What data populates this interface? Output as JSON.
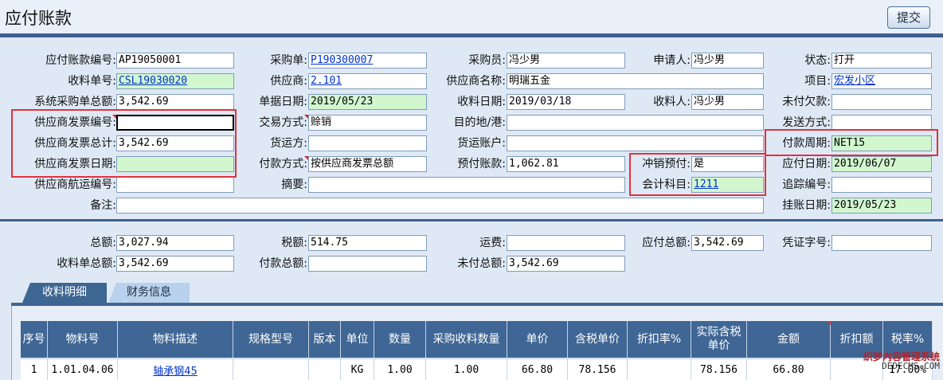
{
  "header": {
    "title": "应付账款",
    "submit_label": "提交"
  },
  "form": {
    "ap_no": {
      "label": "应付账款编号:",
      "value": "AP19050001"
    },
    "po": {
      "label": "采购单:",
      "value": "P190300007"
    },
    "buyer": {
      "label": "采购员:",
      "value": "冯少男"
    },
    "applicant": {
      "label": "申请人:",
      "value": "冯少男"
    },
    "status": {
      "label": "状态:",
      "value": "打开"
    },
    "receipt_no": {
      "label": "收料单号:",
      "value": "CSL19030020"
    },
    "supplier": {
      "label": "供应商:",
      "value": "2.101"
    },
    "supplier_name": {
      "label": "供应商名称:",
      "value": "明瑞五金"
    },
    "project": {
      "label": "项目:",
      "value": "宏发小区"
    },
    "sys_po_amount": {
      "label": "系统采购单总额:",
      "value": "3,542.69"
    },
    "doc_date": {
      "label": "单据日期:",
      "value": "2019/05/23"
    },
    "receipt_date": {
      "label": "收料日期:",
      "value": "2019/03/18"
    },
    "receiver": {
      "label": "收料人:",
      "value": "冯少男"
    },
    "unpaid_debt": {
      "label": "未付欠款:",
      "value": ""
    },
    "invoice_no": {
      "label": "供应商发票编号:",
      "value": ""
    },
    "trade_mode": {
      "label": "交易方式:",
      "value": "赊销"
    },
    "destination": {
      "label": "目的地/港:",
      "value": ""
    },
    "ship_mode": {
      "label": "发送方式:",
      "value": ""
    },
    "invoice_total": {
      "label": "供应商发票总计:",
      "value": "3,542.69"
    },
    "carrier": {
      "label": "货运方:",
      "value": ""
    },
    "carrier_account": {
      "label": "货运账户:",
      "value": ""
    },
    "pay_term": {
      "label": "付款周期:",
      "value": "NET15"
    },
    "invoice_date": {
      "label": "供应商发票日期:",
      "value": ""
    },
    "pay_method": {
      "label": "付款方式:",
      "value": "按供应商发票总额"
    },
    "prepay_account": {
      "label": "预付账款:",
      "value": "1,062.81"
    },
    "offset_prepay": {
      "label": "冲销预付:",
      "value": "是"
    },
    "due_date": {
      "label": "应付日期:",
      "value": "2019/06/07"
    },
    "shipping_no": {
      "label": "供应商航运编号:",
      "value": ""
    },
    "summary": {
      "label": "摘要:",
      "value": ""
    },
    "account_subject": {
      "label": "会计科目:",
      "value": "1211"
    },
    "tracking_no": {
      "label": "追踪编号:",
      "value": ""
    },
    "remark": {
      "label": "备注:",
      "value": ""
    },
    "posting_date": {
      "label": "挂账日期:",
      "value": "2019/05/23"
    }
  },
  "totals": {
    "total": {
      "label": "总额:",
      "value": "3,027.94"
    },
    "tax": {
      "label": "税额:",
      "value": "514.75"
    },
    "freight": {
      "label": "运费:",
      "value": ""
    },
    "payable_total": {
      "label": "应付总额:",
      "value": "3,542.69"
    },
    "voucher_no": {
      "label": "凭证字号:",
      "value": ""
    },
    "receipt_total": {
      "label": "收料单总额:",
      "value": "3,542.69"
    },
    "paid_total": {
      "label": "付款总额:",
      "value": ""
    },
    "unpaid_total": {
      "label": "未付总额:",
      "value": "3,542.69"
    }
  },
  "tabs": [
    {
      "label": "收料明细"
    },
    {
      "label": "财务信息"
    }
  ],
  "grid": {
    "headers": [
      "序号",
      "物料号",
      "物料描述",
      "规格型号",
      "版本",
      "单位",
      "数量",
      "采购收料数量",
      "单价",
      "含税单价",
      "折扣率%",
      "实际含税单价",
      "金额",
      "折扣额",
      "税率%"
    ],
    "rows": [
      [
        "1",
        "1.01.04.06",
        "轴承钢45",
        "",
        "",
        "KG",
        "1.00",
        "1.00",
        "66.80",
        "78.156",
        "",
        "78.156",
        "66.80",
        "",
        "17.00%"
      ]
    ]
  },
  "watermark": {
    "line1": "织梦内容管理系统",
    "line2": "DEDECMS.COM"
  }
}
